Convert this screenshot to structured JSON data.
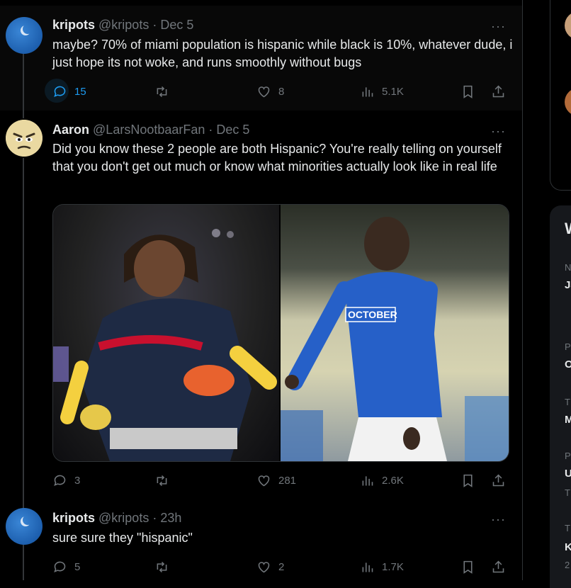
{
  "tweets": [
    {
      "name": "kripots",
      "handle": "@kripots",
      "separator": "·",
      "date": "Dec 5",
      "more": "···",
      "text": "maybe? 70% of miami population is hispanic while black is 10%, whatever dude, i just hope its not woke, and runs smoothly without bugs",
      "replies": "15",
      "likes": "8",
      "views": "5.1K"
    },
    {
      "name": "Aaron",
      "handle": "@LarsNootbaarFan",
      "separator": "·",
      "date": "Dec 5",
      "more": "···",
      "text": "Did you know these 2 people are both Hispanic? You're really telling on yourself that you don't get out much or know what minorities actually look like in real life",
      "replies": "3",
      "likes": "281",
      "views": "2.6K"
    },
    {
      "name": "kripots",
      "handle": "@kripots",
      "separator": "·",
      "date": "23h",
      "more": "···",
      "text": "sure sure they \"hispanic\"",
      "replies": "5",
      "likes": "2",
      "views": "1.7K"
    }
  ],
  "sidebar": {
    "trend_fragments": [
      "W",
      "N",
      "Ja",
      "P",
      "O",
      "T",
      "M",
      "P",
      "U",
      "T",
      "T",
      "K",
      "2"
    ]
  },
  "colors": {
    "background": "#000000",
    "text": "#e7e9ea",
    "secondary": "#71767b",
    "accent": "#1d9bf0",
    "border": "#2f3336"
  },
  "icons": [
    "reply-icon",
    "retweet-icon",
    "like-icon",
    "views-icon",
    "bookmark-icon",
    "share-icon",
    "more-icon"
  ]
}
